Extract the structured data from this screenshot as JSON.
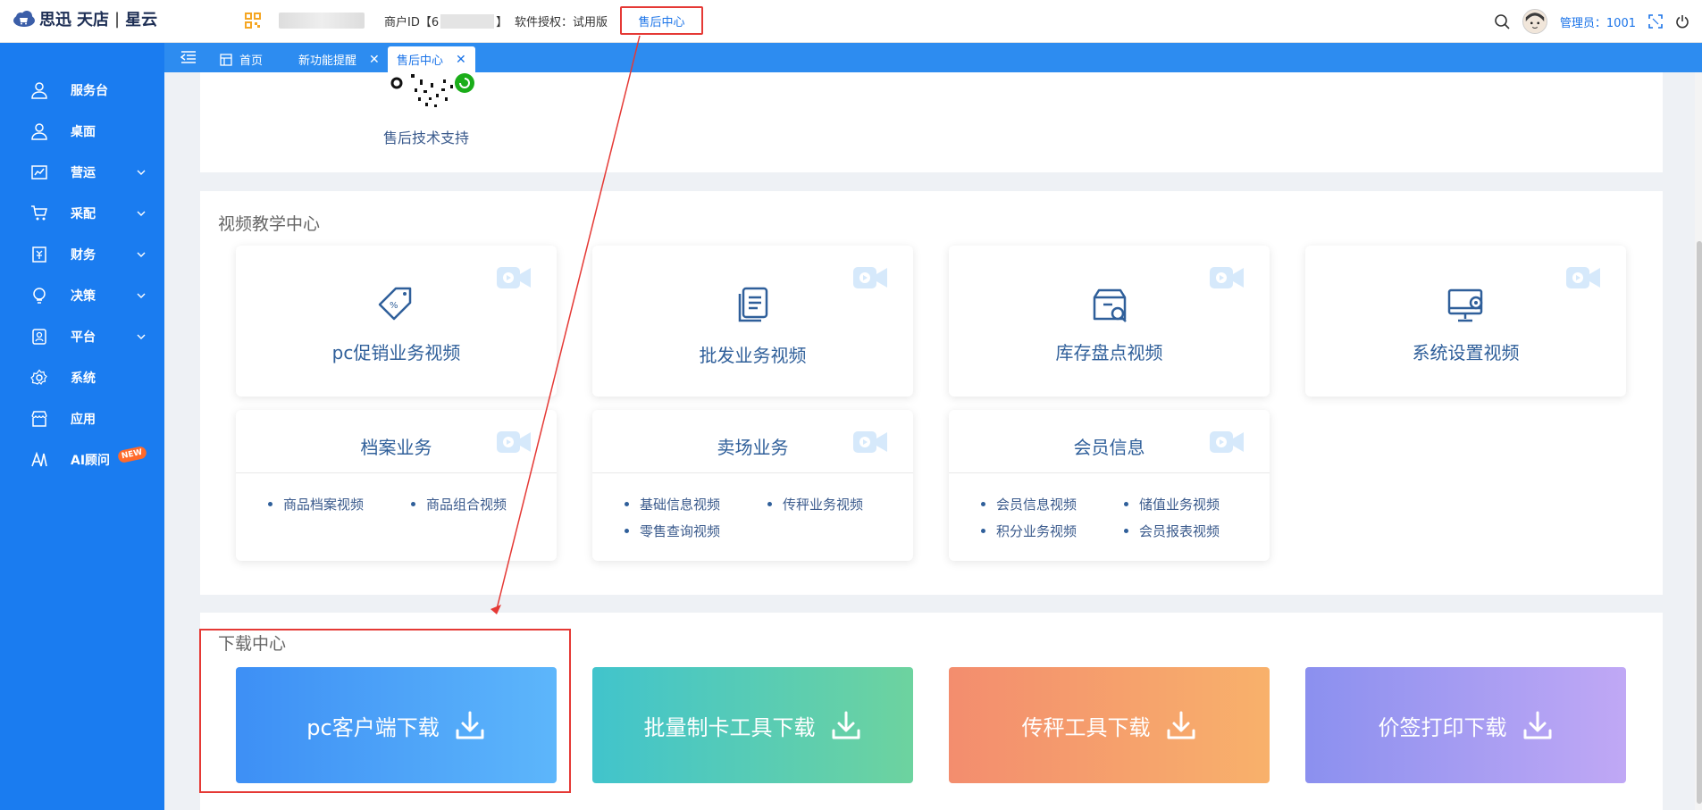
{
  "header": {
    "logo_brand": "思迅",
    "logo_product": "天店",
    "logo_edition": "星云",
    "merchant_prefix": "商户ID【6",
    "merchant_suffix": "】",
    "license_text": "软件授权：试用版",
    "service_link": "售后中心",
    "admin_label": "管理员：1001"
  },
  "sidebar": {
    "items": [
      {
        "label": "服务台",
        "icon": "user-icon"
      },
      {
        "label": "桌面",
        "icon": "user-icon"
      },
      {
        "label": "营运",
        "icon": "chart-icon"
      },
      {
        "label": "采配",
        "icon": "cart-icon"
      },
      {
        "label": "财务",
        "icon": "finance-icon"
      },
      {
        "label": "决策",
        "icon": "bulb-icon"
      },
      {
        "label": "平台",
        "icon": "platform-icon"
      },
      {
        "label": "系统",
        "icon": "gear-icon"
      },
      {
        "label": "应用",
        "icon": "store-icon"
      },
      {
        "label": "AI顾问",
        "icon": "ai-icon"
      }
    ],
    "new_badge": "NEW"
  },
  "tabs": [
    {
      "label": "首页"
    },
    {
      "label": "新功能提醒"
    },
    {
      "label": "售后中心"
    }
  ],
  "support": {
    "label": "售后技术支持"
  },
  "video_center": {
    "title": "视频教学中心",
    "cards": [
      {
        "title": "pc促销业务视频",
        "icon": "promo-tag-icon"
      },
      {
        "title": "批发业务视频",
        "icon": "document-icon"
      },
      {
        "title": "库存盘点视频",
        "icon": "inventory-box-icon"
      },
      {
        "title": "系统设置视频",
        "icon": "monitor-gear-icon"
      }
    ],
    "list_cards": [
      {
        "title": "档案业务",
        "links": [
          "商品档案视频",
          "商品组合视频"
        ]
      },
      {
        "title": "卖场业务",
        "links": [
          "基础信息视频",
          "传秤业务视频",
          "零售查询视频"
        ]
      },
      {
        "title": "会员信息",
        "links": [
          "会员信息视频",
          "储值业务视频",
          "积分业务视频",
          "会员报表视频"
        ]
      }
    ]
  },
  "download_center": {
    "title": "下载中心",
    "buttons": [
      {
        "label": "pc客户端下载"
      },
      {
        "label": "批量制卡工具下载"
      },
      {
        "label": "传秤工具下载"
      },
      {
        "label": "价签打印下载"
      }
    ]
  }
}
